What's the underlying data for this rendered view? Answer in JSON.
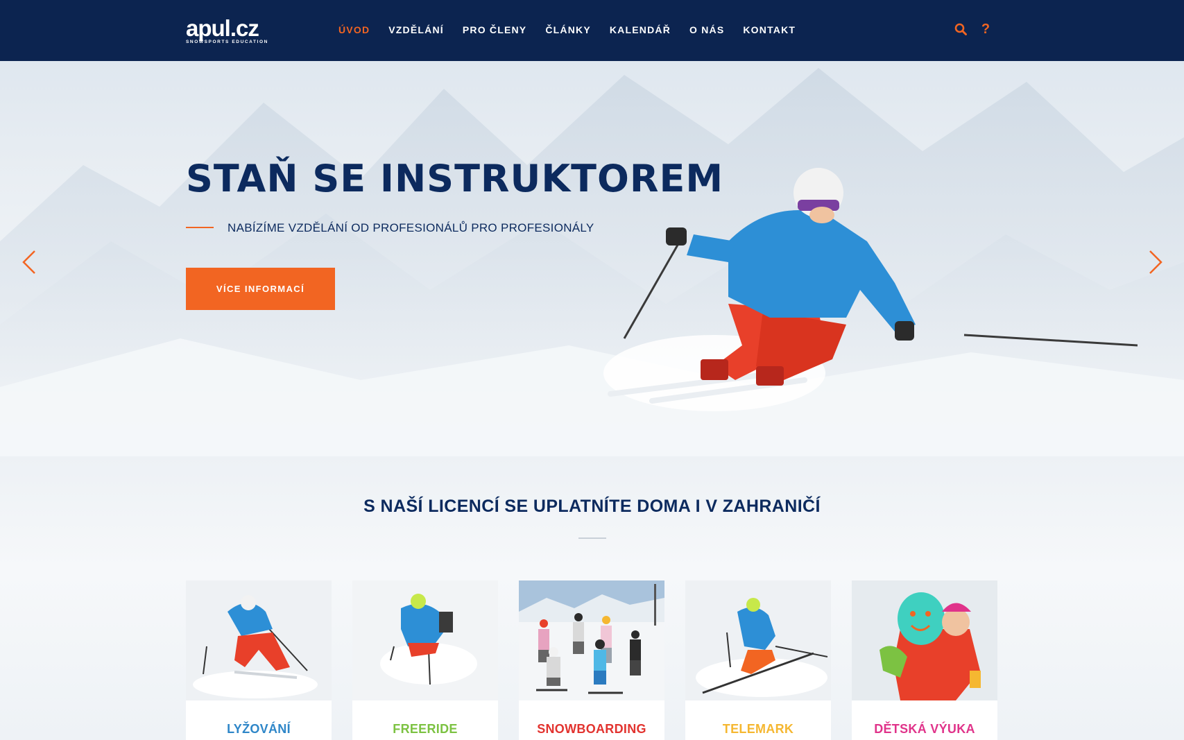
{
  "header": {
    "logo_text": "apul.cz",
    "logo_subtitle": "SNOWSPORTS EDUCATION",
    "nav": [
      {
        "label": "ÚVOD",
        "active": true
      },
      {
        "label": "VZDĚLÁNÍ",
        "active": false
      },
      {
        "label": "PRO ČLENY",
        "active": false
      },
      {
        "label": "ČLÁNKY",
        "active": false
      },
      {
        "label": "KALENDÁŘ",
        "active": false
      },
      {
        "label": "O NÁS",
        "active": false
      },
      {
        "label": "KONTAKT",
        "active": false
      }
    ],
    "icons": [
      "search-icon",
      "help-icon"
    ],
    "help_glyph": "?"
  },
  "hero": {
    "title": "STAŇ SE INSTRUKTOREM",
    "subtitle": "NABÍZÍME VZDĚLÁNÍ OD PROFESIONÁLŮ PRO PROFESIONÁLY",
    "button_label": "VÍCE INFORMACÍ",
    "prev_icon": "chevron-left-icon",
    "next_icon": "chevron-right-icon"
  },
  "section": {
    "title": "S NAŠÍ LICENCÍ SE UPLATNÍTE DOMA I V ZAHRANIČÍ",
    "cards": [
      {
        "label": "LYŽOVÁNÍ",
        "color": "#2e86c8"
      },
      {
        "label": "FREERIDE",
        "color": "#7cc242"
      },
      {
        "label": "SNOWBOARDING",
        "color": "#e2332f"
      },
      {
        "label": "TELEMARK",
        "color": "#f5b731"
      },
      {
        "label": "DĚTSKÁ VÝUKA",
        "color": "#e0338a"
      }
    ]
  },
  "colors": {
    "navy": "#0c2450",
    "accent": "#f26522"
  }
}
